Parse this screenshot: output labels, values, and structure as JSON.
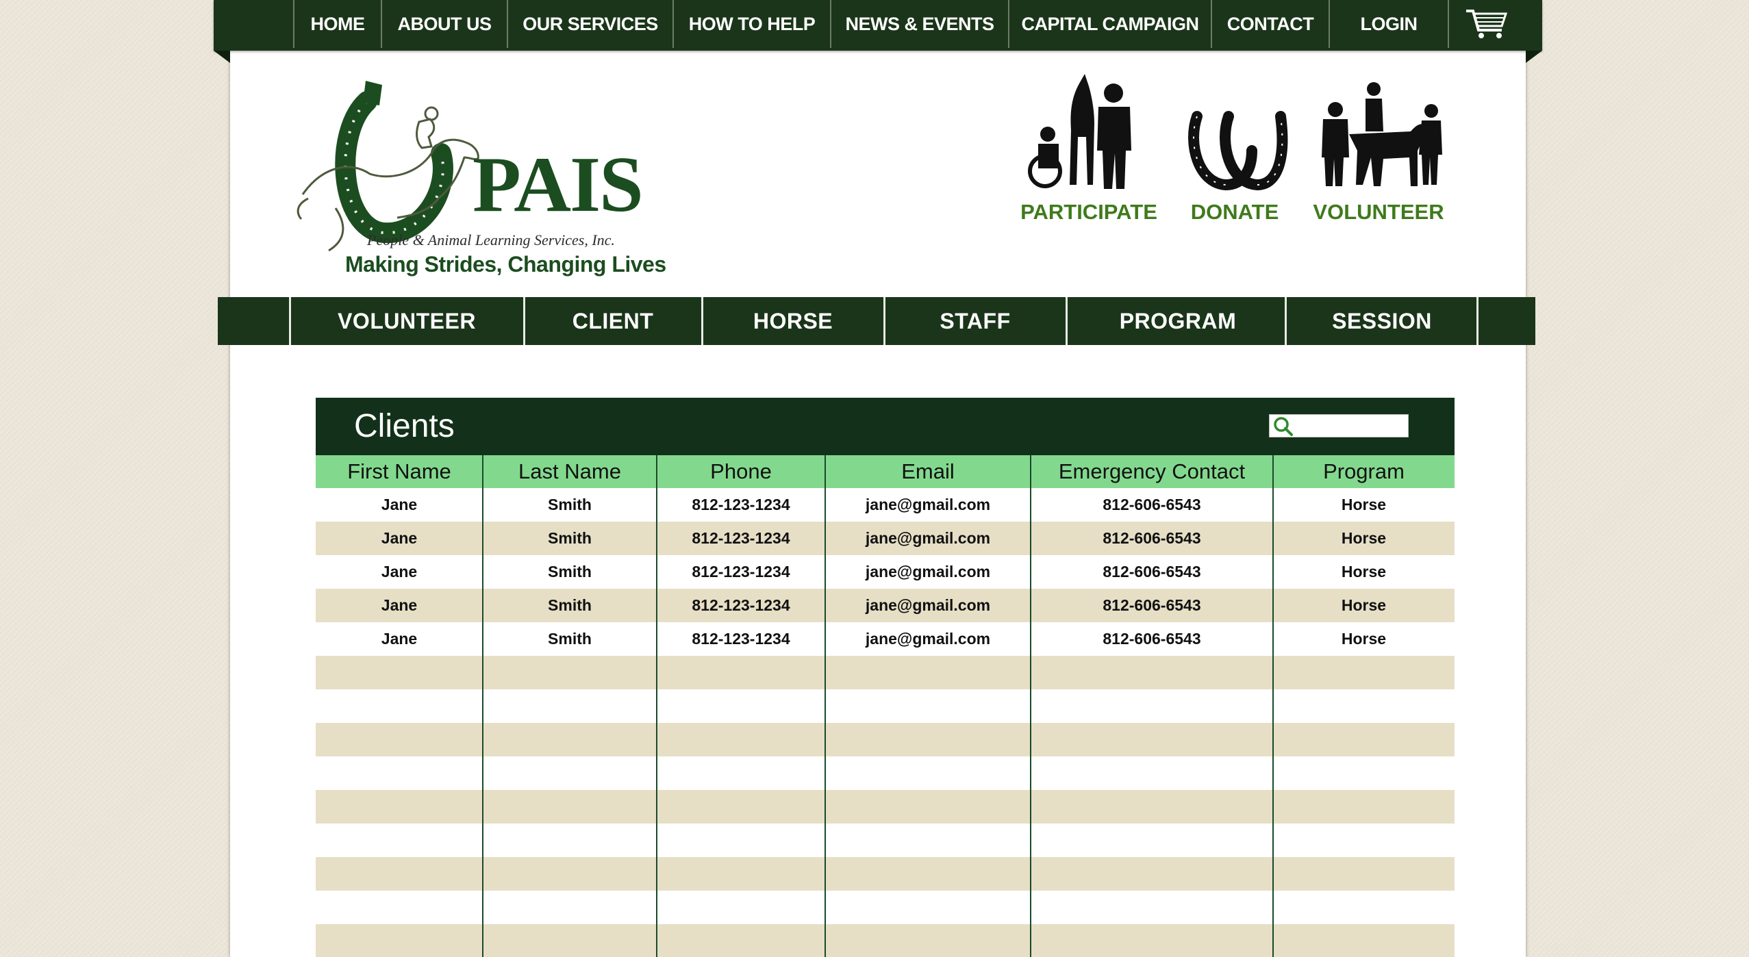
{
  "top_nav": {
    "items": [
      "HOME",
      "ABOUT US",
      "OUR SERVICES",
      "HOW TO HELP",
      "NEWS & EVENTS",
      "CAPITAL CAMPAIGN",
      "CONTACT",
      "LOGIN"
    ],
    "cart_icon": "cart-icon"
  },
  "logo": {
    "name": "PAIS",
    "subtitle": "People & Animal Learning Services, Inc.",
    "tagline": "Making Strides, Changing Lives"
  },
  "actions": {
    "participate": "PARTICIPATE",
    "donate": "DONATE",
    "volunteer": "VOLUNTEER"
  },
  "sub_nav": {
    "items": [
      "VOLUNTEER",
      "CLIENT",
      "HORSE",
      "STAFF",
      "PROGRAM",
      "SESSION"
    ]
  },
  "clients": {
    "title": "Clients",
    "search": {
      "value": "",
      "placeholder": ""
    },
    "columns": [
      "First Name",
      "Last Name",
      "Phone",
      "Email",
      "Emergency Contact",
      "Program"
    ],
    "rows": [
      [
        "Jane",
        "Smith",
        "812-123-1234",
        "jane@gmail.com",
        "812-606-6543",
        "Horse"
      ],
      [
        "Jane",
        "Smith",
        "812-123-1234",
        "jane@gmail.com",
        "812-606-6543",
        "Horse"
      ],
      [
        "Jane",
        "Smith",
        "812-123-1234",
        "jane@gmail.com",
        "812-606-6543",
        "Horse"
      ],
      [
        "Jane",
        "Smith",
        "812-123-1234",
        "jane@gmail.com",
        "812-606-6543",
        "Horse"
      ],
      [
        "Jane",
        "Smith",
        "812-123-1234",
        "jane@gmail.com",
        "812-606-6543",
        "Horse"
      ]
    ],
    "empty_rows": 9
  },
  "colors": {
    "dark_green": "#1b351a",
    "header_green": "#13311a",
    "column_header": "#82d98e",
    "stripe": "#e6dfc6",
    "accent_green": "#3f7a1c",
    "logo_green": "#1c4d20"
  }
}
